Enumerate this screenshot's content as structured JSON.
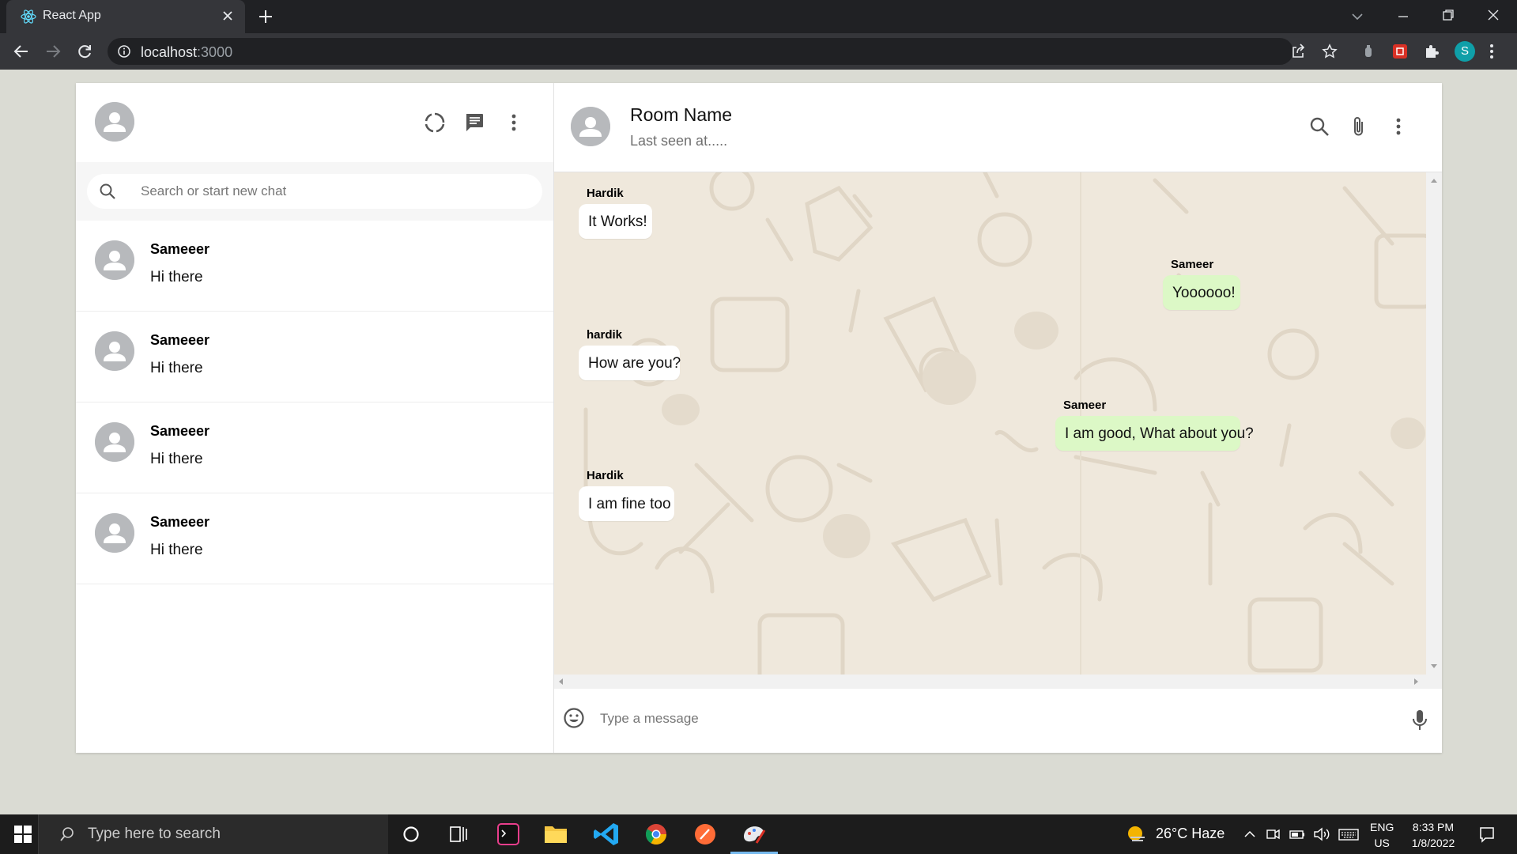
{
  "browser": {
    "tab_title": "React App",
    "url_host": "localhost",
    "url_port": ":3000"
  },
  "sidebar": {
    "search_placeholder": "Search or start new chat",
    "chats": [
      {
        "name": "Sameeer",
        "preview": "Hi there"
      },
      {
        "name": "Sameeer",
        "preview": "Hi there"
      },
      {
        "name": "Sameeer",
        "preview": "Hi there"
      },
      {
        "name": "Sameeer",
        "preview": "Hi there"
      }
    ]
  },
  "chat": {
    "room_name": "Room Name",
    "last_seen": "Last seen at.....",
    "messages": [
      {
        "name": "Hardik",
        "text": "It Works!",
        "sent": false
      },
      {
        "name": "Sameer",
        "text": "Yoooooo!",
        "sent": true
      },
      {
        "name": "hardik",
        "text": "How are you?",
        "sent": false
      },
      {
        "name": "Sameer",
        "text": "I am good, What about you?",
        "sent": true
      },
      {
        "name": "Hardik",
        "text": "I am fine too",
        "sent": false
      }
    ],
    "input_placeholder": "Type a message"
  },
  "taskbar": {
    "search_text": "Type here to search",
    "weather": "26°C  Haze",
    "lang_line1": "ENG",
    "lang_line2": "US",
    "time": "8:33 PM",
    "date": "1/8/2022"
  },
  "colors": {
    "sent_bubble": "#dcf8c6",
    "received_bubble": "#ffffff",
    "chat_background": "#efe8dc",
    "profile_badge": "#0f9fa8"
  },
  "profile_initial": "S"
}
